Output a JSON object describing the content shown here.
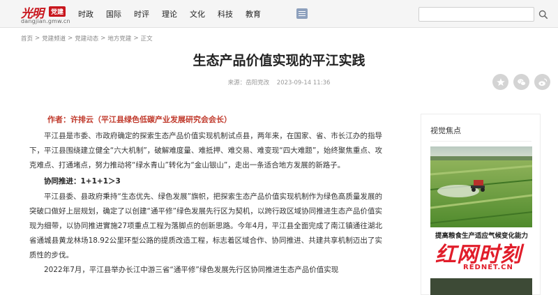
{
  "header": {
    "logo_script": "光明",
    "logo_badge": "党建",
    "logo_domain": "dangjian.gmw.cn",
    "nav": [
      "时政",
      "国际",
      "时评",
      "理论",
      "文化",
      "科技",
      "教育"
    ],
    "menu_icon": "menu-icon",
    "search_placeholder": "",
    "search_icon": "search-icon"
  },
  "breadcrumb": [
    "首页",
    "党建频道",
    "党建动态",
    "地方党建",
    "正文"
  ],
  "article": {
    "title": "生态产品价值实现的平江实践",
    "source": "来源：岳阳党改",
    "datetime": "2023-09-14 11:36",
    "author": "作者：许排云（平江县绿色低碳产业发展研究会会长）",
    "paragraphs": [
      "平江县是市委、市政府确定的探索生态产品价值实现机制试点县，两年来，在国家、省、市长江办的指导下，平江县围绕建立健全“六大机制”，破解难度量、难抵押、难交易、难变现“四大难题”，始终聚焦重点、攻克难点、打通堵点，努力推动将“绿水青山”转化为“金山银山”，走出一条适合地方发展的新路子。",
      "平江县委、县政府秉持“生态优先、绿色发展”旗帜，把探索生态产品价值实现机制作为绿色高质量发展的突破口做好上层规划，确定了以创建“通平修”绿色发展先行区为契机，以跨行政区域协同推进生态产品价值实现为细带，以协同推进實施27项重点工程为落脚点的创新思路。今年4月，平江县全面完成了南江镇通往湖北省通城县黄龙林场18.92公里环型公路的提质改造工程，标志着区域合作、协同推进、共建共享机制迈出了实质性的步伐。",
      "2022年7月，平江县举办长江中游三省“通平修”绿色发展先行区协同推进生态产品价值实现"
    ],
    "subhead": "协同推进：1+1+1＞3"
  },
  "share": {
    "icons": [
      "favorite-icon",
      "wechat-icon",
      "weibo-icon"
    ]
  },
  "sidebar": {
    "title": "视觉焦点",
    "caption": "提高粮食生产适应气候变化能力"
  },
  "watermark": {
    "main": "红网时刻",
    "sub": "REDNET.CN"
  },
  "colors": {
    "brand_red": "#c8161d",
    "author_red": "#c0392b",
    "nav_bg": "#f5f5f5",
    "share_bg": "#d4d4d4"
  }
}
